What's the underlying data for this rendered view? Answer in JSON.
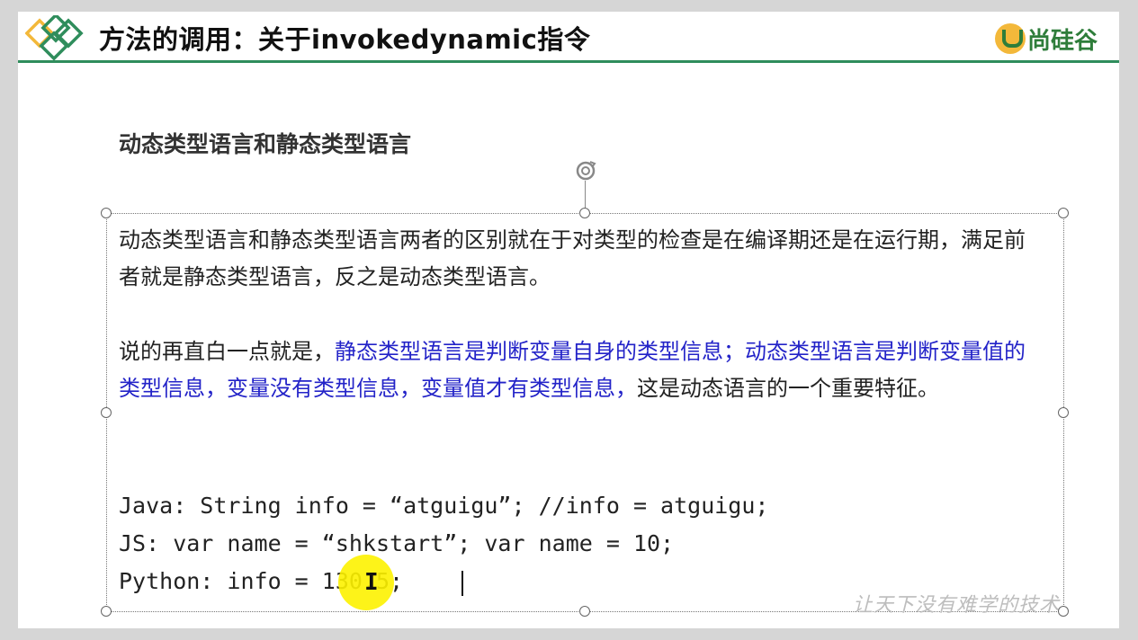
{
  "header": {
    "title": "方法的调用：关于invokedynamic指令",
    "brand": "尚硅谷",
    "colors": {
      "rule": "#2f8d5c",
      "brand": "#2e7d3a",
      "brand_mark": "#f3b83a"
    }
  },
  "subtitle": "动态类型语言和静态类型语言",
  "paragraph1": "动态类型语言和静态类型语言两者的区别就在于对类型的检查是在编译期还是在运行期，满足前者就是静态类型语言，反之是动态类型语言。",
  "paragraph2": {
    "intro": "说的再直白一点就是，",
    "highlight": "静态类型语言是判断变量自身的类型信息；动态类型语言是判断变量值的类型信息，变量没有类型信息，变量值才有类型信息，",
    "tail": "这是动态语言的一个重要特征。",
    "highlight_color": "#2323c8"
  },
  "code": {
    "java": "Java: String info = “atguigu”; //info = atguigu;",
    "js": "JS: var name = “shkstart”; var name = 10;",
    "python": "Python: info = 130.5;"
  },
  "watermark": "让天下没有难学的技术",
  "icons": [
    "diamond-logo-icon",
    "brand-logo-icon",
    "rotate-icon",
    "ibeam-cursor-icon"
  ]
}
